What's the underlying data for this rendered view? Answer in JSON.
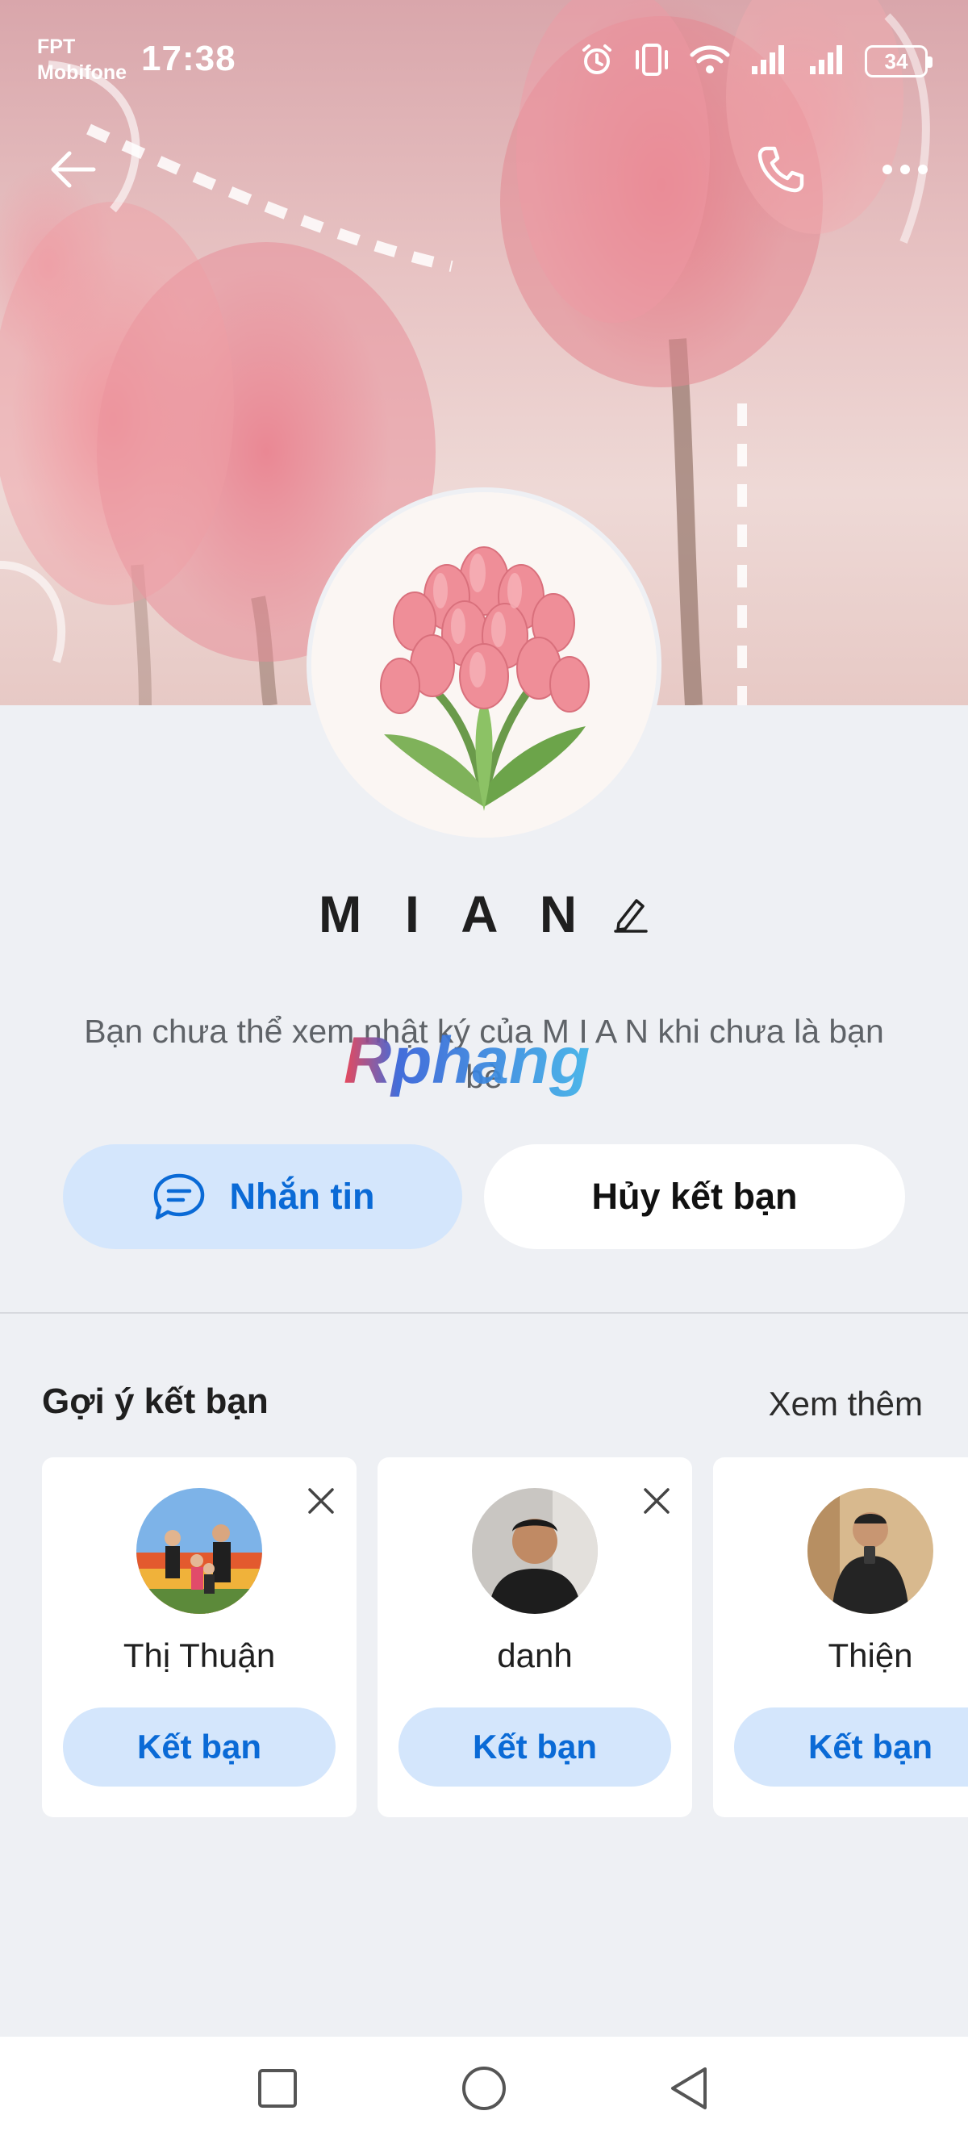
{
  "status_bar": {
    "carrier_line1": "FPT",
    "carrier_line2": "Mobifone",
    "time": "17:38",
    "battery": "34",
    "icons": [
      "alarm-icon",
      "vibrate-icon",
      "wifi-icon",
      "signal-icon",
      "signal-icon",
      "battery-icon"
    ]
  },
  "header": {
    "back_icon": "arrow-left-icon",
    "call_icon": "phone-icon",
    "more_icon": "more-horizontal-icon"
  },
  "profile": {
    "name": "M I A N",
    "edit_icon": "pencil-icon",
    "notice": "Bạn chưa thể xem nhật ký của M I A N khi chưa là bạn bè",
    "watermark_text": "Rphang"
  },
  "actions": {
    "message_label": "Nhắn tin",
    "unfriend_label": "Hủy kết bạn"
  },
  "suggestions": {
    "title": "Gợi ý kết bạn",
    "see_more": "Xem thêm",
    "items": [
      {
        "name": "Thị Thuận",
        "button": "Kết bạn"
      },
      {
        "name": "danh",
        "button": "Kết bạn"
      },
      {
        "name": "Thiện",
        "button": "Kết bạn"
      }
    ]
  },
  "colors": {
    "accent": "#0a6ad6",
    "accent_bg": "#d4e6fc",
    "page_bg": "#eef0f4"
  }
}
